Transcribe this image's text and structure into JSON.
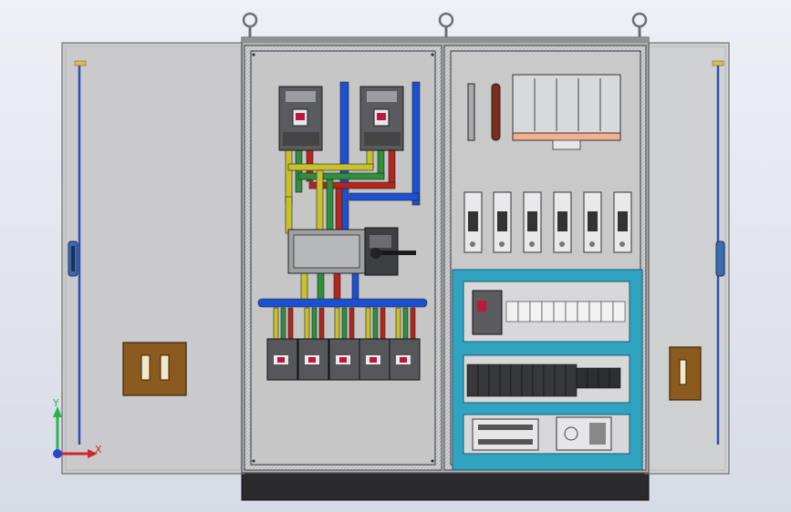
{
  "triad": {
    "x_label": "X",
    "y_label": "Y"
  },
  "colors": {
    "background_top": "#eef0f6",
    "background_bottom": "#d7dbe6",
    "door": "#c9c9cb",
    "panel": "#c6c6c6",
    "frame": "#a9a9ab",
    "busbar_blue": "#1d4fd1",
    "busbar_yellow": "#c9c12a",
    "busbar_green": "#2f8f3a",
    "busbar_red": "#b3261e",
    "din_frame_cyan": "#2fa3c0",
    "handle_brown": "#8a5a1e",
    "plinth": "#2b2b2d"
  },
  "components": {
    "main_breakers": 2,
    "outgoing_breakers": 5,
    "fuse_holders": 6,
    "upper_terminal_blocks": 10,
    "lower_terminal_blocks": 10,
    "relays": 6
  },
  "icons": [
    "lifting-eye-icon",
    "door-handle-icon",
    "axis-triad-icon"
  ]
}
